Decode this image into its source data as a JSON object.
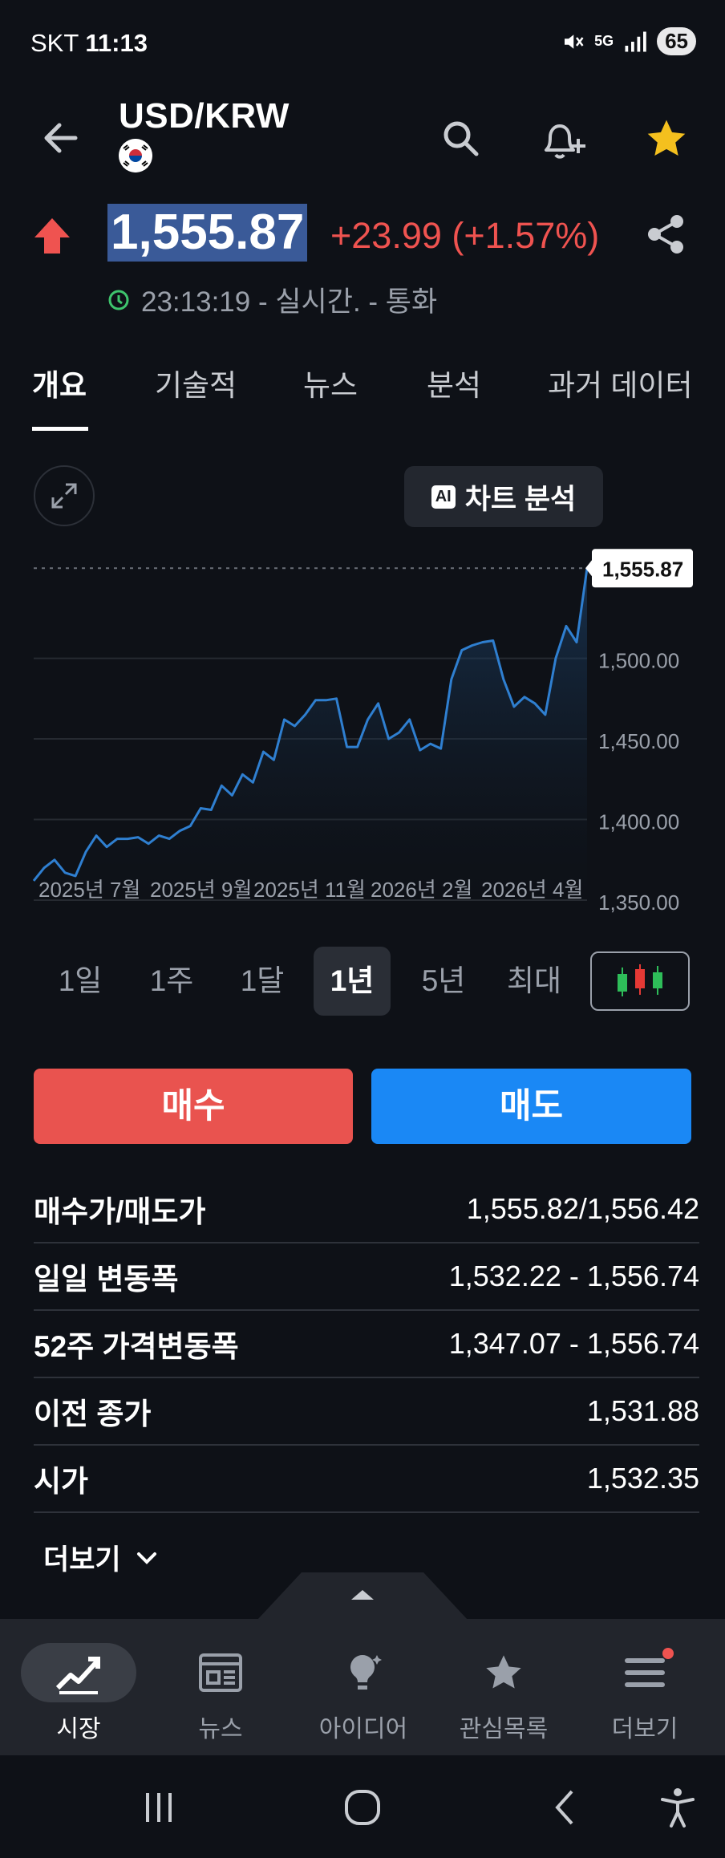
{
  "status_bar": {
    "carrier": "SKT",
    "time": "11:13",
    "network": "5G",
    "battery": "65"
  },
  "header": {
    "title": "USD/KRW",
    "flag": "korea-flag"
  },
  "quote": {
    "price": "1,555.87",
    "change": "+23.99 (+1.57%)",
    "meta": "23:13:19 - 실시간. - 통화",
    "direction": "up",
    "up_color": "#ef5350"
  },
  "tabs": [
    {
      "label": "개요",
      "active": true
    },
    {
      "label": "기술적"
    },
    {
      "label": "뉴스"
    },
    {
      "label": "분석"
    },
    {
      "label": "과거 데이터"
    }
  ],
  "chart_controls": {
    "ai_badge": "AI",
    "ai_label": "차트 분석"
  },
  "chart_data": {
    "type": "area",
    "title": "",
    "xlabel": "",
    "ylabel": "",
    "x_tick_labels": [
      "2025년 7월",
      "2025년 9월",
      "2025년 11월",
      "2026년 2월",
      "2026년 4월"
    ],
    "y_tick_labels": [
      "1,500.00",
      "1,450.00",
      "1,400.00",
      "1,350.00"
    ],
    "last_price_label": "1,555.87",
    "ylim": [
      1350,
      1560
    ],
    "grid": true,
    "line_color": "#2f7fd0",
    "series": [
      {
        "values": [
          1362,
          1370,
          1375,
          1367,
          1365,
          1380,
          1390,
          1383,
          1388,
          1388,
          1389,
          1385,
          1390,
          1388,
          1393,
          1396,
          1407,
          1406,
          1421,
          1415,
          1428,
          1423,
          1442,
          1437,
          1462,
          1458,
          1465,
          1474,
          1474,
          1475,
          1445,
          1445,
          1462,
          1472,
          1450,
          1454,
          1462,
          1443,
          1447,
          1444,
          1487,
          1505,
          1508,
          1510,
          1511,
          1487,
          1470,
          1476,
          1472,
          1465,
          1500,
          1520,
          1510,
          1555.87
        ]
      }
    ]
  },
  "ranges": [
    {
      "label": "1일"
    },
    {
      "label": "1주"
    },
    {
      "label": "1달"
    },
    {
      "label": "1년",
      "active": true
    },
    {
      "label": "5년"
    },
    {
      "label": "최대"
    }
  ],
  "actions": {
    "buy": "매수",
    "sell": "매도",
    "buy_color": "#e9534f",
    "sell_color": "#1a88f5"
  },
  "stats": [
    {
      "label": "매수가/매도가",
      "value": "1,555.82/1,556.42"
    },
    {
      "label": "일일 변동폭",
      "value": "1,532.22 - 1,556.74"
    },
    {
      "label": "52주 가격변동폭",
      "value": "1,347.07 - 1,556.74"
    },
    {
      "label": "이전 종가",
      "value": "1,531.88"
    },
    {
      "label": "시가",
      "value": "1,532.35"
    }
  ],
  "more_label": "더보기",
  "nav": [
    {
      "label": "시장",
      "icon": "chart-trend-icon",
      "active": true
    },
    {
      "label": "뉴스",
      "icon": "newspaper-icon"
    },
    {
      "label": "아이디어",
      "icon": "lightbulb-icon"
    },
    {
      "label": "관심목록",
      "icon": "star-icon"
    },
    {
      "label": "더보기",
      "icon": "menu-icon"
    }
  ]
}
